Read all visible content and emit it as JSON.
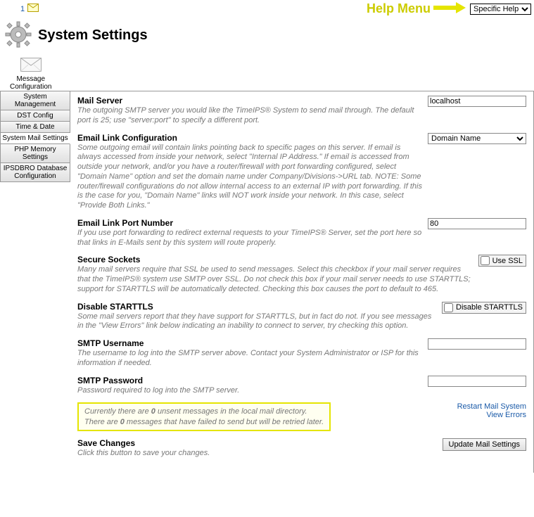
{
  "topbar": {
    "notif_count": "1",
    "help_label": "Help Menu",
    "help_select": "Specific Help"
  },
  "header": {
    "title": "System Settings"
  },
  "tab": {
    "line1": "Message",
    "line2": "Configuration"
  },
  "sidenav": [
    "System Management",
    "DST Config",
    "Time & Date",
    "System Mail Settings",
    "PHP Memory Settings",
    "IPSDBRO Database Configuration"
  ],
  "settings": {
    "mail_server": {
      "label": "Mail Server",
      "desc": "The outgoing SMTP server you would like the TimeIPS® System to send mail through. The default port is 25; use \"server:port\" to specify a different port.",
      "value": "localhost"
    },
    "email_link_conf": {
      "label": "Email Link Configuration",
      "desc": "Some outgoing email will contain links pointing back to specific pages on this server. If email is always accessed from inside your network, select \"Internal IP Address.\" If email is accessed from outside your network, and/or you have a router/firewall with port forwarding configured, select \"Domain Name\" option and set the domain name under Company/Divisions->URL tab. NOTE: Some router/firewall configurations do not allow internal access to an external IP with port forwarding. If this is the case for you, \"Domain Name\" links will NOT work inside your network. In this case, select \"Provide Both Links.\"",
      "value": "Domain Name"
    },
    "email_link_port": {
      "label": "Email Link Port Number",
      "desc": "If you use port forwarding to redirect external requests to your TimeIPS® Server, set the port here so that links in E-Mails sent by this system will route properly.",
      "value": "80"
    },
    "secure_sockets": {
      "label": "Secure Sockets",
      "desc": "Many mail servers require that SSL be used to send messages. Select this checkbox if your mail server requires that the TimeIPS® system use SMTP over SSL. Do not check this box if your mail server needs to use STARTTLS; support for STARTTLS will be automatically detected. Checking this box causes the port to default to 465.",
      "chk_label": "Use SSL"
    },
    "disable_starttls": {
      "label": "Disable STARTTLS",
      "desc": "Some mail servers report that they have support for STARTTLS, but in fact do not. If you see messages in the \"View Errors\" link below indicating an inability to connect to server, try checking this option.",
      "chk_label": "Disable STARTTLS"
    },
    "smtp_user": {
      "label": "SMTP Username",
      "desc": "The username to log into the SMTP server above. Contact your System Administrator or ISP for this information if needed.",
      "value": ""
    },
    "smtp_pass": {
      "label": "SMTP Password",
      "desc": "Password required to log into the SMTP server.",
      "value": ""
    },
    "save": {
      "label": "Save Changes",
      "desc": "Click this button to save your changes.",
      "btn": "Update Mail Settings"
    }
  },
  "status": {
    "l1a": "Currently there are ",
    "l1b": "0",
    "l1c": " unsent messages in the local mail directory.",
    "l2a": "There are ",
    "l2b": "0",
    "l2c": " messages that have failed to send but will be retried later."
  },
  "links": {
    "restart": "Restart Mail System",
    "errors": "View Errors"
  }
}
